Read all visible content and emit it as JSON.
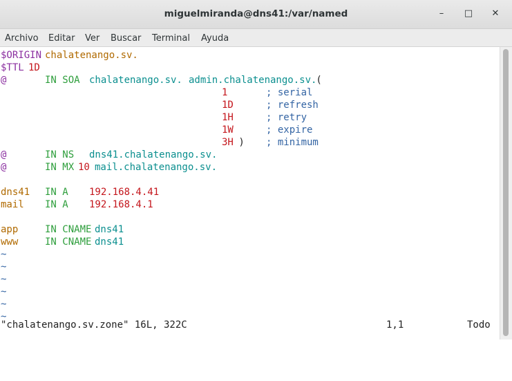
{
  "window": {
    "title": "miguelmiranda@dns41:/var/named"
  },
  "menu": [
    "Archivo",
    "Editar",
    "Ver",
    "Buscar",
    "Terminal",
    "Ayuda"
  ],
  "colors": {
    "brown": "#b06a00",
    "darkred": "#c4161c",
    "green": "#2e9e3c",
    "teal": "#0b8f8f",
    "purple": "#8b2fa0",
    "blue": "#3465a4",
    "black": "#222222"
  },
  "editor": {
    "lines": [
      [
        {
          "t": "$ORIGIN ",
          "c": "purple"
        },
        {
          "t": "chalatenango.sv.",
          "c": "brown"
        }
      ],
      [
        {
          "t": "$TTL ",
          "c": "purple"
        },
        {
          "t": "1D",
          "c": "darkred"
        }
      ],
      [
        {
          "t": "@",
          "c": "purple"
        },
        {
          "t": "       "
        },
        {
          "t": "IN SOA",
          "c": "green"
        },
        {
          "t": "  "
        },
        {
          "t": "chalatenango.sv.",
          "c": "teal"
        },
        {
          "t": "  "
        },
        {
          "t": "admin.chalatenango.sv.",
          "c": "teal"
        },
        {
          "t": " ("
        }
      ],
      [
        {
          "t": "                                        "
        },
        {
          "t": "1",
          "c": "darkred"
        },
        {
          "t": "       "
        },
        {
          "t": "; serial",
          "c": "blue"
        }
      ],
      [
        {
          "t": "                                        "
        },
        {
          "t": "1D",
          "c": "darkred"
        },
        {
          "t": "      "
        },
        {
          "t": "; refresh",
          "c": "blue"
        }
      ],
      [
        {
          "t": "                                        "
        },
        {
          "t": "1H",
          "c": "darkred"
        },
        {
          "t": "      "
        },
        {
          "t": "; retry",
          "c": "blue"
        }
      ],
      [
        {
          "t": "                                        "
        },
        {
          "t": "1W",
          "c": "darkred"
        },
        {
          "t": "      "
        },
        {
          "t": "; expire",
          "c": "blue"
        }
      ],
      [
        {
          "t": "                                        "
        },
        {
          "t": "3H",
          "c": "darkred"
        },
        {
          "t": " )    "
        },
        {
          "t": "; minimum",
          "c": "blue"
        }
      ],
      [
        {
          "t": "@",
          "c": "purple"
        },
        {
          "t": "       "
        },
        {
          "t": "IN NS",
          "c": "green"
        },
        {
          "t": "   "
        },
        {
          "t": "dns41.chalatenango.sv.",
          "c": "teal"
        }
      ],
      [
        {
          "t": "@",
          "c": "purple"
        },
        {
          "t": "       "
        },
        {
          "t": "IN MX",
          "c": "green"
        },
        {
          "t": " "
        },
        {
          "t": "10",
          "c": "darkred"
        },
        {
          "t": " "
        },
        {
          "t": "mail.chalatenango.sv.",
          "c": "teal"
        }
      ],
      [],
      [
        {
          "t": "dns41",
          "c": "brown"
        },
        {
          "t": "   "
        },
        {
          "t": "IN A",
          "c": "green"
        },
        {
          "t": "    "
        },
        {
          "t": "192.168.4.41",
          "c": "darkred"
        }
      ],
      [
        {
          "t": "mail",
          "c": "brown"
        },
        {
          "t": "    "
        },
        {
          "t": "IN A",
          "c": "green"
        },
        {
          "t": "    "
        },
        {
          "t": "192.168.4.1",
          "c": "darkred"
        }
      ],
      [],
      [
        {
          "t": "app",
          "c": "brown"
        },
        {
          "t": "     "
        },
        {
          "t": "IN CNAME",
          "c": "green"
        },
        {
          "t": " "
        },
        {
          "t": "dns41",
          "c": "teal"
        }
      ],
      [
        {
          "t": "www",
          "c": "brown"
        },
        {
          "t": "     "
        },
        {
          "t": "IN CNAME",
          "c": "green"
        },
        {
          "t": " "
        },
        {
          "t": "dns41",
          "c": "teal"
        }
      ],
      [
        {
          "t": "~",
          "c": "blue"
        }
      ],
      [
        {
          "t": "~",
          "c": "blue"
        }
      ],
      [
        {
          "t": "~",
          "c": "blue"
        }
      ],
      [
        {
          "t": "~",
          "c": "blue"
        }
      ],
      [
        {
          "t": "~",
          "c": "blue"
        }
      ],
      [
        {
          "t": "~",
          "c": "blue"
        }
      ]
    ],
    "status": {
      "file": "\"chalatenango.sv.zone\" 16L, 322C",
      "position": "1,1",
      "scroll": "Todo"
    }
  },
  "icons": {
    "minimize": "minimize-icon",
    "maximize": "maximize-icon",
    "close": "close-icon"
  }
}
